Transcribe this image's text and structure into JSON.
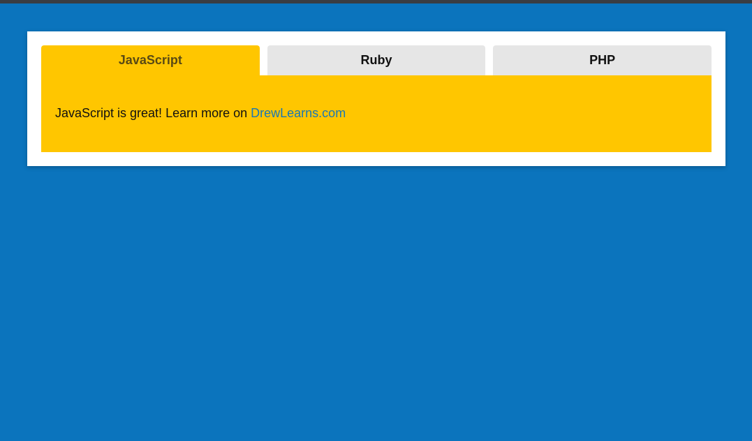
{
  "tabs": [
    {
      "label": "JavaScript",
      "active": true
    },
    {
      "label": "Ruby",
      "active": false
    },
    {
      "label": "PHP",
      "active": false
    }
  ],
  "panel": {
    "text": "JavaScript is great! Learn more on ",
    "link_text": "DrewLearns.com"
  },
  "colors": {
    "background": "#0b74bd",
    "active_tab": "#ffc600",
    "inactive_tab": "#e6e6e6",
    "link": "#1a78b4"
  }
}
